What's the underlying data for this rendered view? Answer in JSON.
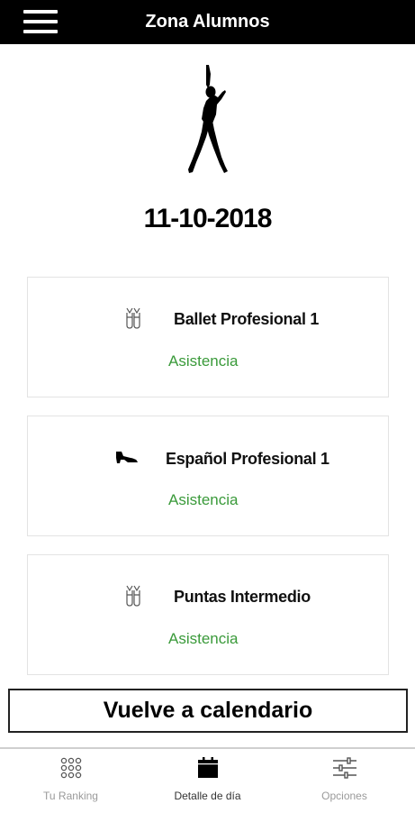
{
  "header": {
    "title": "Zona Alumnos",
    "menu_icon": "hamburger-icon"
  },
  "hero": {
    "icon": "dancer-silhouette-icon",
    "date": "11-10-2018"
  },
  "classes": [
    {
      "name": "Ballet Profesional 1",
      "status": "Asistencia",
      "icon": "ballet-shoes-icon"
    },
    {
      "name": "Español Profesional 1",
      "status": "Asistencia",
      "icon": "heel-shoe-icon"
    },
    {
      "name": "Puntas Intermedio",
      "status": "Asistencia",
      "icon": "ballet-shoes-icon"
    }
  ],
  "actions": {
    "back_to_calendar": "Vuelve a calendario"
  },
  "bottom_nav": [
    {
      "label": "Tu Ranking",
      "icon": "grid-icon",
      "active": false
    },
    {
      "label": "Detalle de día",
      "icon": "calendar-icon",
      "active": true
    },
    {
      "label": "Opciones",
      "icon": "sliders-icon",
      "active": false
    }
  ],
  "colors": {
    "header_bg": "#000000",
    "status_green": "#3a9a3a",
    "nav_inactive": "#9a9a9a"
  }
}
